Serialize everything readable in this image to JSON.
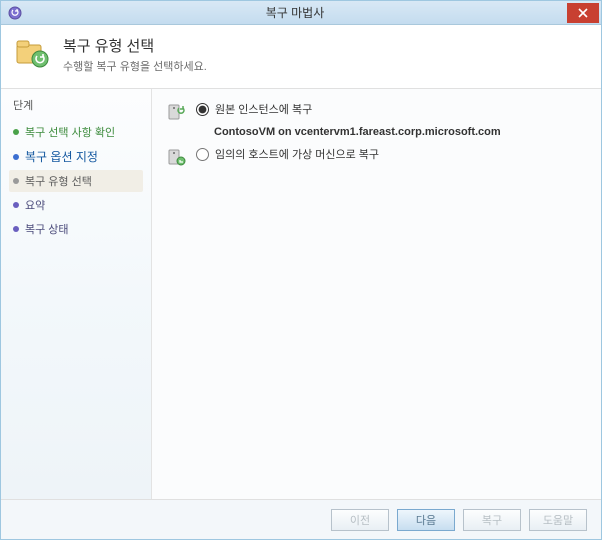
{
  "window": {
    "title": "복구 마법사"
  },
  "header": {
    "title": "복구 유형 선택",
    "subtitle": "수행할 복구 유형을 선택하세요."
  },
  "sidebar": {
    "heading": "단계",
    "steps": [
      {
        "label": "복구 선택 사항 확인"
      },
      {
        "label": "복구 옵션 지정"
      },
      {
        "label": "복구 유형 선택"
      },
      {
        "label": "요약"
      },
      {
        "label": "복구 상태"
      }
    ]
  },
  "options": {
    "opt1": {
      "label": "원본 인스턴스에 복구",
      "detail": "ContosoVM on vcentervm1.fareast.corp.microsoft.com",
      "checked": true
    },
    "opt2": {
      "label": "임의의 호스트에 가상 머신으로 복구",
      "checked": false
    }
  },
  "footer": {
    "back": "이전",
    "next": "다음",
    "recover": "복구",
    "help": "도움말"
  }
}
